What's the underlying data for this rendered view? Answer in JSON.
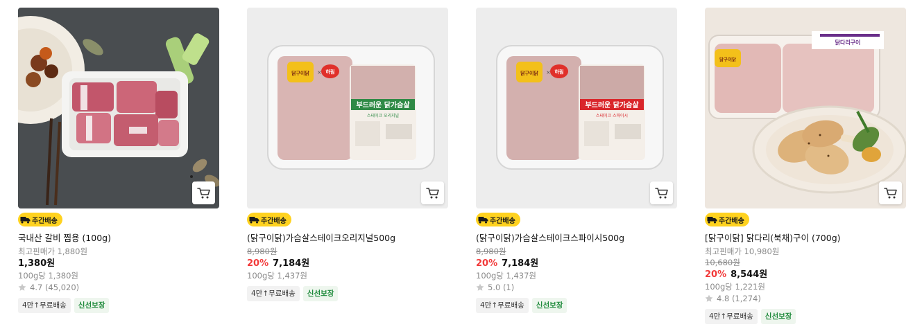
{
  "products": [
    {
      "name": "국내산 갈비 찜용 (100g)",
      "badge": "주간배송",
      "ref_label": "최고핀매가 1,880원",
      "price": "1,380원",
      "unit_price": "100g당 1,380원",
      "rating": "4.7 (45,020)",
      "tags": [
        "4만↑무료배송",
        "신선보장"
      ]
    },
    {
      "name": "(닭구이닭)가슴살스테이크오리지널500g",
      "badge": "주간배송",
      "orig_price": "8,980원",
      "discount": "20%",
      "price": "7,184원",
      "unit_price": "100g당 1,437원",
      "tags": [
        "4만↑무료배송",
        "신선보장"
      ]
    },
    {
      "name": "(닭구이닭)가슴살스테이크스파이시500g",
      "badge": "주간배송",
      "orig_price": "8,980원",
      "discount": "20%",
      "price": "7,184원",
      "unit_price": "100g당 1,437원",
      "rating": "5.0 (1)",
      "tags": [
        "4만↑무료배송",
        "신선보장"
      ]
    },
    {
      "name": "[닭구이닭] 닭다리(북채)구이 (700g)",
      "badge": "주간배송",
      "ref_label": "최고핀매가 10,980원",
      "orig_price": "10,680원",
      "discount": "20%",
      "price": "8,544원",
      "unit_price": "100g당 1,221원",
      "rating": "4.8 (1,274)",
      "tags": [
        "4만↑무료배송",
        "신선보장"
      ]
    }
  ],
  "package_text": {
    "brand": "닭구이닭",
    "partner": "하림",
    "title": "부드러운 닭가슴살",
    "original_sub": "스테이크 오리지널",
    "spicy_sub": "스테이크 스파이시",
    "leg_label": "닭다리구이"
  },
  "colors": {
    "discount": "#f23a3a",
    "badge": "#ffd21f",
    "fresh_tag": "#1e8a3b",
    "star": "#c8c8c8"
  },
  "icons": {
    "cart": "cart-icon",
    "truck": "truck-icon",
    "star": "star-icon"
  }
}
